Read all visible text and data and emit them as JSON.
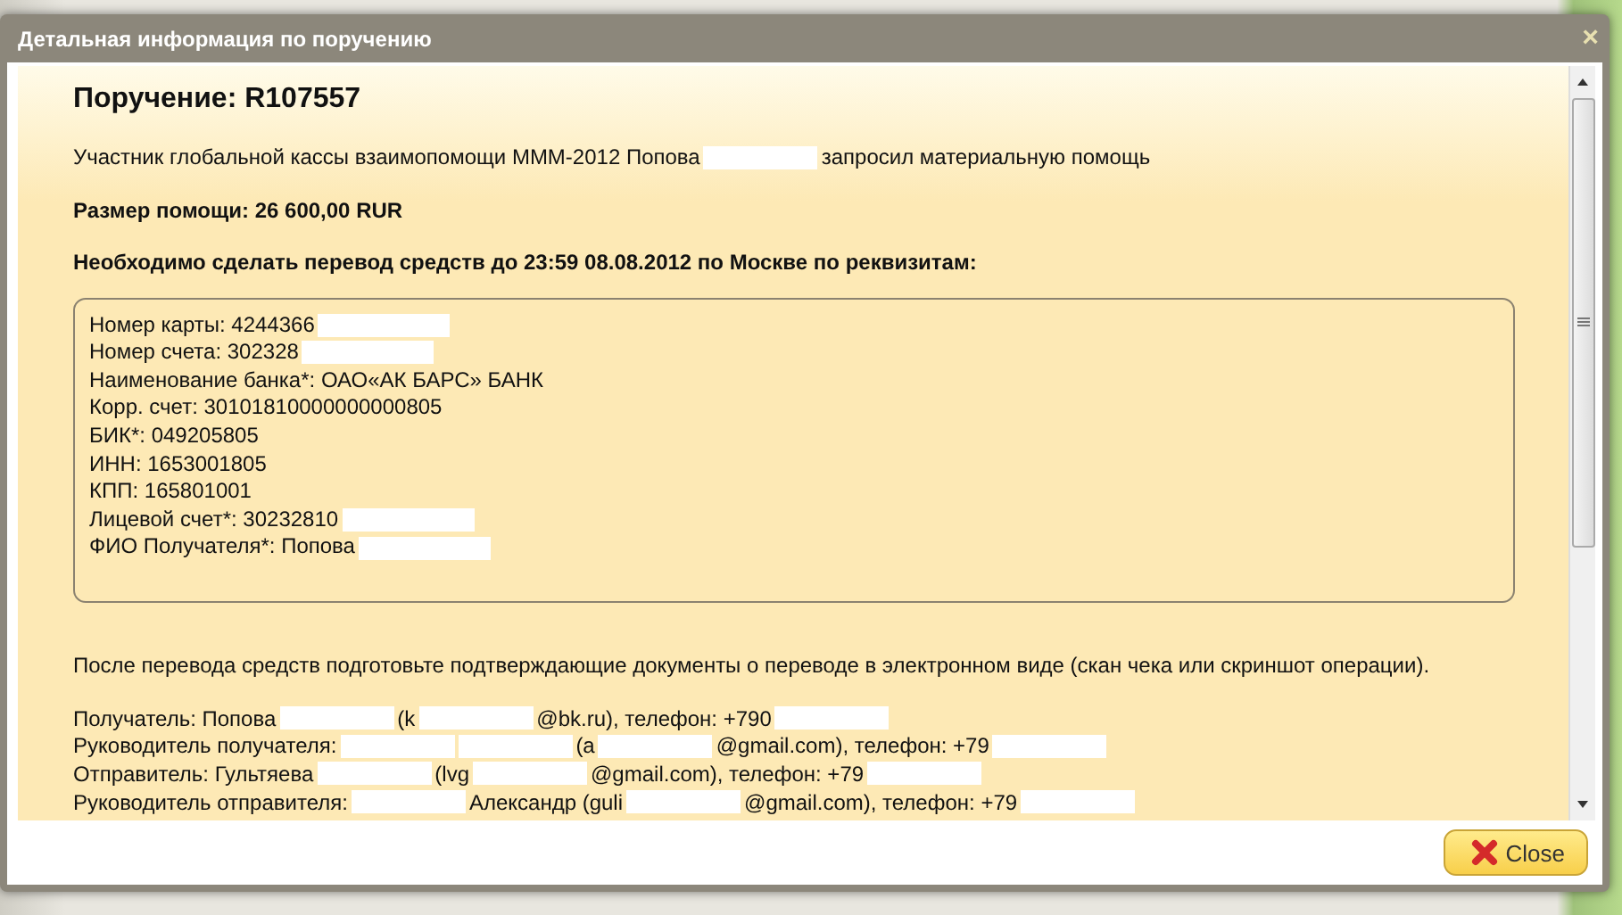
{
  "window": {
    "title": "Детальная информация по поручению",
    "close_glyph": "×"
  },
  "heading": "Поручение: R107557",
  "intro": [
    {
      "kind": "text",
      "text": "Участник глобальной кассы взаимопомощи МММ-2012 Попова"
    },
    {
      "kind": "redacted"
    },
    {
      "kind": "text",
      "text": "запросил материальную помощь"
    }
  ],
  "amount": "Размер помощи: 26 600,00 RUR",
  "deadline": "Необходимо сделать перевод средств до 23:59 08.08.2012 по Москве по реквизитам:",
  "requisites": [
    [
      {
        "kind": "text",
        "text": "Номер карты: 4244366"
      },
      {
        "kind": "redacted"
      }
    ],
    [
      {
        "kind": "text",
        "text": "Номер счета: 302328"
      },
      {
        "kind": "redacted"
      }
    ],
    [
      {
        "kind": "text",
        "text": "Наименование банка*: ОАО«АК БАРС» БАНК"
      }
    ],
    [
      {
        "kind": "text",
        "text": "Корр. счет: 30101810000000000805"
      }
    ],
    [
      {
        "kind": "text",
        "text": "БИК*: 049205805"
      }
    ],
    [
      {
        "kind": "text",
        "text": "ИНН: 1653001805"
      }
    ],
    [
      {
        "kind": "text",
        "text": "КПП: 165801001"
      }
    ],
    [
      {
        "kind": "text",
        "text": "Лицевой счет*: 30232810"
      },
      {
        "kind": "redacted"
      }
    ],
    [
      {
        "kind": "text",
        "text": "ФИО Получателя*: Попова"
      },
      {
        "kind": "redacted"
      }
    ]
  ],
  "instruction": "После перевода средств подготовьте подтверждающие документы о переводе в электронном виде (скан чека или скриншот операции).",
  "contacts": [
    [
      {
        "kind": "text",
        "text": "Получатель: Попова"
      },
      {
        "kind": "redacted"
      },
      {
        "kind": "text",
        "text": "(k"
      },
      {
        "kind": "redacted"
      },
      {
        "kind": "text",
        "text": "@bk.ru), телефон: +790"
      },
      {
        "kind": "redacted"
      }
    ],
    [
      {
        "kind": "text",
        "text": "Руководитель получателя:"
      },
      {
        "kind": "redacted"
      },
      {
        "kind": "redacted"
      },
      {
        "kind": "text",
        "text": "(a"
      },
      {
        "kind": "redacted"
      },
      {
        "kind": "text",
        "text": "@gmail.com), телефон: +79"
      },
      {
        "kind": "redacted"
      }
    ],
    [
      {
        "kind": "text",
        "text": "Отправитель: Гультяева"
      },
      {
        "kind": "redacted"
      },
      {
        "kind": "text",
        "text": "(lvg"
      },
      {
        "kind": "redacted"
      },
      {
        "kind": "text",
        "text": "@gmail.com), телефон: +79"
      },
      {
        "kind": "redacted"
      }
    ],
    [
      {
        "kind": "text",
        "text": "Руководитель отправителя:"
      },
      {
        "kind": "redacted"
      },
      {
        "kind": "text",
        "text": "Александр (guli"
      },
      {
        "kind": "redacted"
      },
      {
        "kind": "text",
        "text": "@gmail.com), телефон: +79"
      },
      {
        "kind": "redacted"
      }
    ]
  ],
  "buttons": [
    {
      "label": "Close"
    }
  ]
}
